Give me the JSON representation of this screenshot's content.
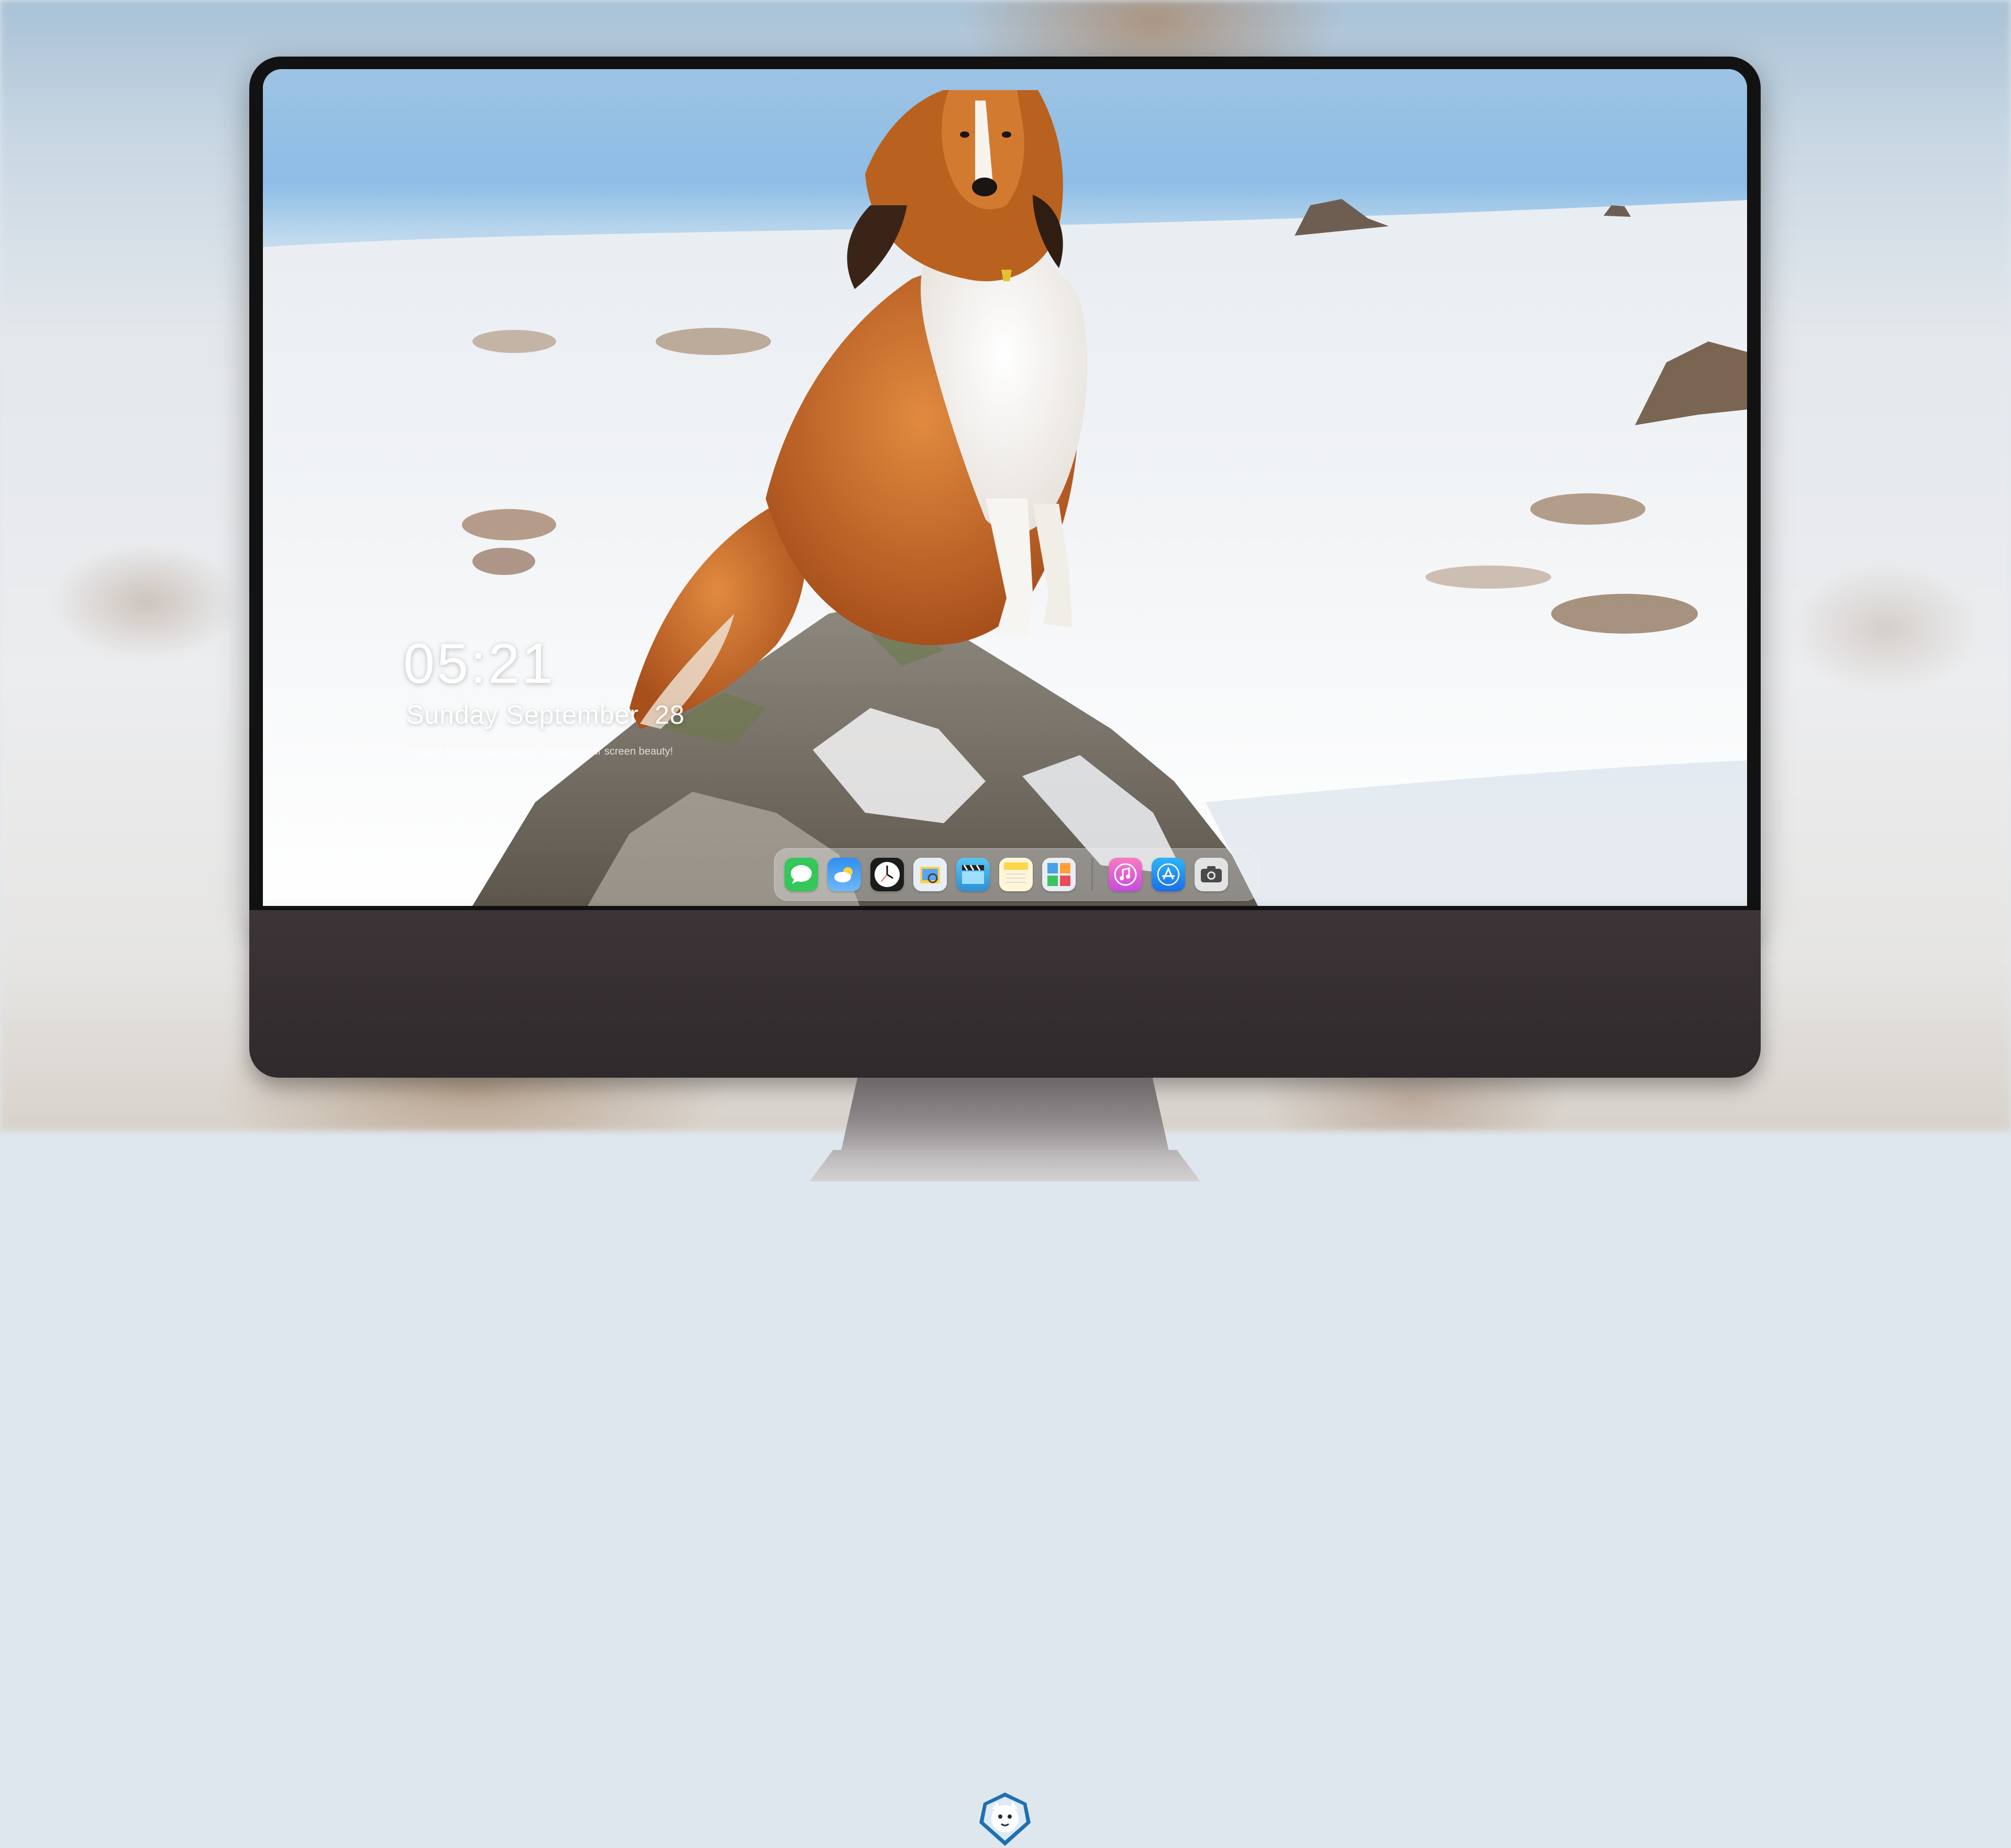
{
  "lock_screen": {
    "time": "05:21",
    "weekday": "Sunday",
    "month": "September",
    "day": "28",
    "tagline": "Provide stunning wallpapers. Elevate your screen beauty!"
  },
  "dock": {
    "apps": [
      {
        "name": "Messages",
        "icon": "messages-icon",
        "color": "#35c759"
      },
      {
        "name": "Weather",
        "icon": "weather-icon",
        "color": "#2f8ff0"
      },
      {
        "name": "Clock",
        "icon": "clock-icon",
        "color": "#1b1b1b"
      },
      {
        "name": "Preview",
        "icon": "preview-icon",
        "color": "#e8eef6"
      },
      {
        "name": "Clips",
        "icon": "clips-icon",
        "color": "#4ab8e8"
      },
      {
        "name": "Notes",
        "icon": "notes-icon",
        "color": "#ffd34a"
      },
      {
        "name": "Photo Booth",
        "icon": "photo-booth-icon",
        "color": "#4b9ee8"
      },
      {
        "name": "Music",
        "icon": "music-icon",
        "color": "#f25ba6"
      },
      {
        "name": "App Store",
        "icon": "app-store-icon",
        "color": "#1e8ef5"
      },
      {
        "name": "Screenshot",
        "icon": "camera-icon",
        "color": "#6c6c6c"
      }
    ]
  },
  "colors": {
    "bezel": "#121212",
    "chin": "#3d3437",
    "sky": "#8fbde6",
    "snow": "#f2f4f6",
    "collie_orange": "#c8621f"
  }
}
